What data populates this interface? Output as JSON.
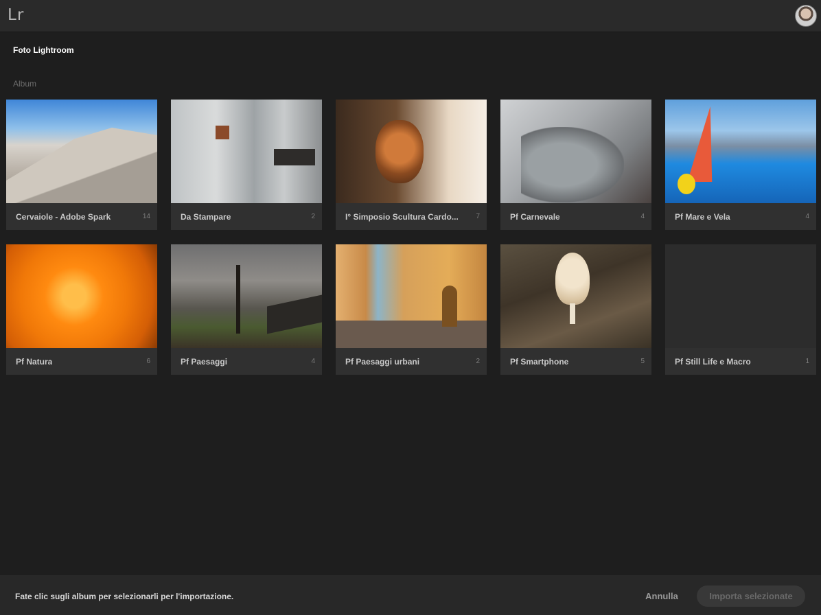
{
  "header": {
    "logo": "Lr",
    "avatar_icon": "user-avatar"
  },
  "page": {
    "title": "Foto Lightroom",
    "section": "Album"
  },
  "albums": [
    {
      "name": "Cervaiole - Adobe Spark",
      "count": "14"
    },
    {
      "name": "Da Stampare",
      "count": "2"
    },
    {
      "name": "I° Simposio Scultura Cardo...",
      "count": "7"
    },
    {
      "name": "Pf Carnevale",
      "count": "4"
    },
    {
      "name": "Pf Mare e Vela",
      "count": "4"
    },
    {
      "name": "Pf Natura",
      "count": "6"
    },
    {
      "name": "Pf Paesaggi",
      "count": "4"
    },
    {
      "name": "Pf Paesaggi urbani",
      "count": "2"
    },
    {
      "name": "Pf Smartphone",
      "count": "5"
    },
    {
      "name": "Pf Still Life e Macro",
      "count": "1"
    }
  ],
  "footer": {
    "hint": "Fate clic sugli album per selezionarli per l'importazione.",
    "cancel_label": "Annulla",
    "import_label": "Importa selezionate"
  }
}
